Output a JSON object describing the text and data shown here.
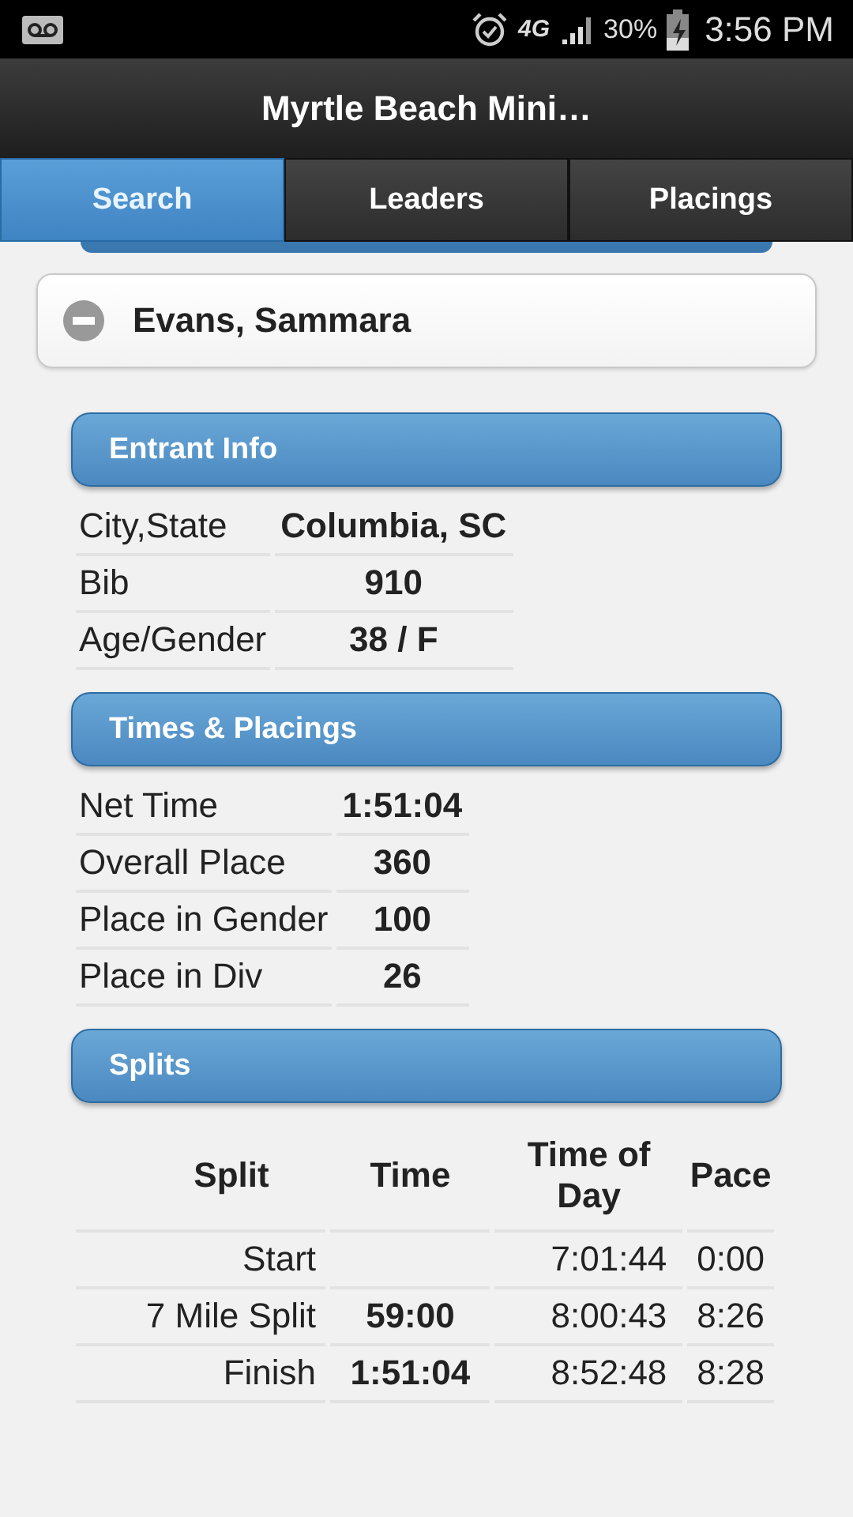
{
  "status_bar": {
    "network": "4G",
    "battery": "30%",
    "time": "3:56 PM"
  },
  "header": {
    "title": "Myrtle Beach Mini…"
  },
  "tabs": [
    {
      "label": "Search",
      "selected": true
    },
    {
      "label": "Leaders",
      "selected": false
    },
    {
      "label": "Placings",
      "selected": false
    }
  ],
  "entrant": {
    "name": "Evans, Sammara",
    "expanded": true
  },
  "sections": [
    {
      "title": "Entrant Info",
      "kind": "pairs",
      "rows": [
        {
          "label": "City,State",
          "value": "Columbia, SC"
        },
        {
          "label": "Bib",
          "value": "910"
        },
        {
          "label": "Age/Gender",
          "value": "38 / F"
        }
      ]
    },
    {
      "title": "Times & Placings",
      "kind": "pairs",
      "rows": [
        {
          "label": "Net Time",
          "value": "1:51:04"
        },
        {
          "label": "Overall Place",
          "value": "360"
        },
        {
          "label": "Place in Gender",
          "value": "100"
        },
        {
          "label": "Place in Div",
          "value": "26"
        }
      ]
    },
    {
      "title": "Splits",
      "kind": "splits",
      "columns": [
        "Split",
        "Time",
        "Time of Day",
        "Pace"
      ],
      "rows": [
        {
          "split": "Start",
          "time_of_day": "7:01:44",
          "pace": "0:00"
        },
        {
          "split": "7 Mile Split",
          "time": "59:00",
          "time_of_day": "8:00:43",
          "pace": "8:26"
        },
        {
          "split": "Finish",
          "time": "1:51:04",
          "time_of_day": "8:52:48",
          "pace": "8:28"
        }
      ]
    }
  ]
}
